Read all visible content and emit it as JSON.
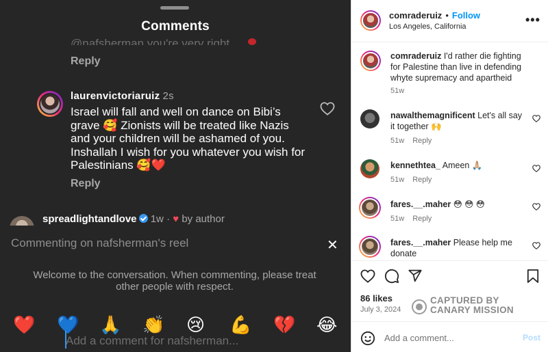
{
  "left": {
    "sheet_title": "Comments",
    "ghost_text": "@nafsherman you're very right",
    "reply_label": "Reply",
    "comment": {
      "username": "laurenvictoriaruiz",
      "time": "2s",
      "text": "Israel will fall and well on dance on Bibi’s grave 🥰 Zionists will be treated like Nazis and your children will be ashamed of you. Inshallah I wish for you whatever you wish for Palestinians 🥰❤️"
    },
    "comment2": {
      "username": "spreadlightandlove",
      "meta": "1w",
      "by_author": "by author"
    },
    "compose_label": "Commenting on nafsherman's reel",
    "welcome": "Welcome to the conversation. When commenting, please treat other people with respect.",
    "emojis": [
      "❤️",
      "💙",
      "🙏",
      "👏",
      "😢",
      "💪",
      "💔",
      "😂"
    ],
    "add_placeholder": "Add a comment for nafsherman..."
  },
  "right": {
    "owner": "comraderuiz",
    "follow_label": "Follow",
    "location": "Los Angeles, California",
    "more": "•••",
    "caption": {
      "user": "comraderuiz",
      "text": "I'd rather die fighting for Palestine than live in defending whyte supremacy and apartheid",
      "time": "51w"
    },
    "comments": [
      {
        "user": "nawalthemagnificent",
        "text": "Let's all say it together 🙌",
        "time": "51w",
        "reply": "Reply"
      },
      {
        "user": "kennethtea_",
        "text": "Ameen 🙏🏼",
        "time": "51w",
        "reply": "Reply"
      },
      {
        "user": "fares.__.maher",
        "text": "😳 😳 😳",
        "time": "51w",
        "reply": "Reply"
      },
      {
        "user": "fares.__.maher",
        "text": "Please help me donate"
      }
    ],
    "likes": "86 likes",
    "date": "July 3, 2024",
    "watermark_line1": "CAPTURED BY",
    "watermark_line2": "CANARY MISSION",
    "add_placeholder": "Add a comment...",
    "post_label": "Post"
  }
}
